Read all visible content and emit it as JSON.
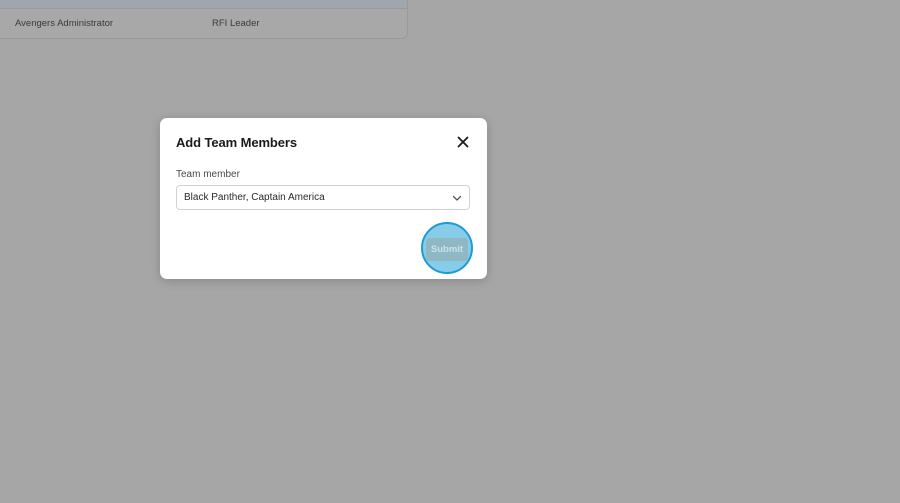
{
  "background": {
    "table": {
      "rows": [
        {
          "name": "Avengers Administrator",
          "role": "RFI Leader"
        }
      ]
    }
  },
  "modal": {
    "title": "Add Team Members",
    "close_icon": "close-icon",
    "team_member": {
      "label": "Team member",
      "value": "Black Panther, Captain America",
      "chevron_icon": "chevron-down-icon"
    },
    "submit_label": "Submit"
  },
  "colors": {
    "overlay": "#a6a6a6",
    "highlight_fill": "#87cde8",
    "highlight_ring": "#1e9ad6",
    "submit_disabled": "#8fb8c4"
  }
}
